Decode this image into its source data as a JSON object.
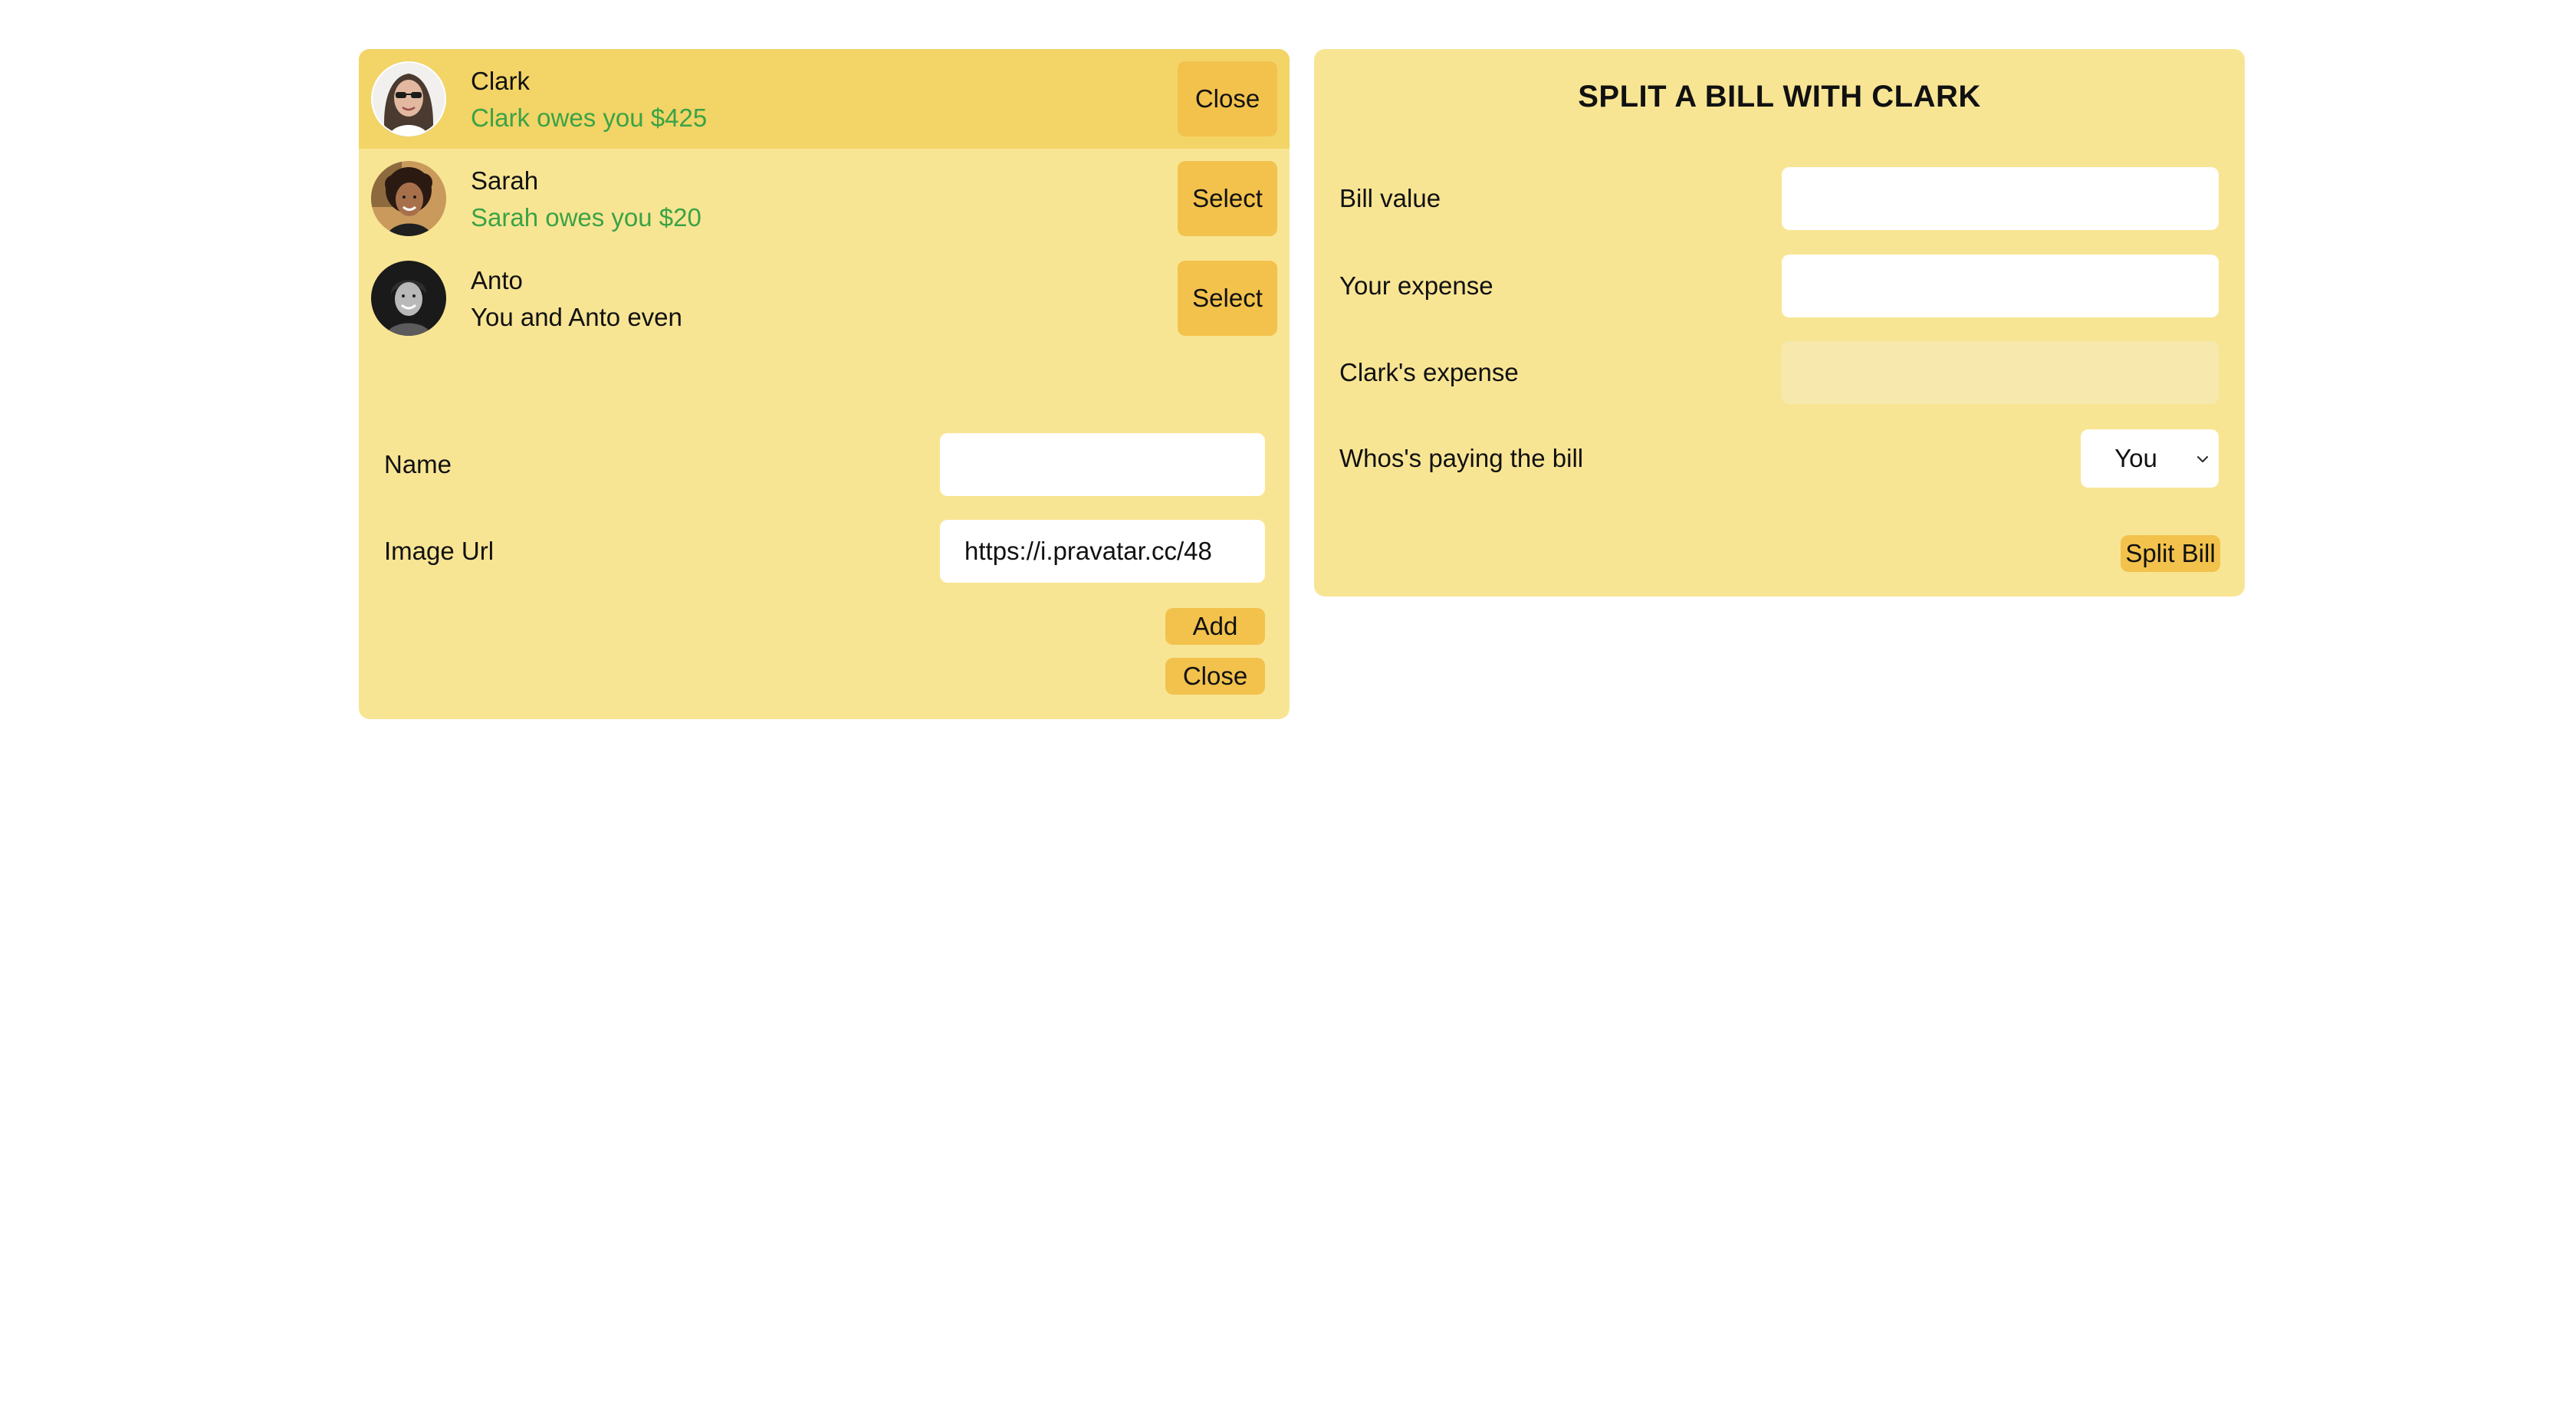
{
  "friends": [
    {
      "name": "Clark",
      "status": "Clark owes you $425",
      "status_color": "#3aa345",
      "button_label": "Close",
      "selected": true,
      "avatar_icon": "avatar-woman-sunglasses"
    },
    {
      "name": "Sarah",
      "status": "Sarah owes you $20",
      "status_color": "#3aa345",
      "button_label": "Select",
      "selected": false,
      "avatar_icon": "avatar-woman-curly-hair"
    },
    {
      "name": "Anto",
      "status": "You and Anto even",
      "status_color": "#111111",
      "button_label": "Select",
      "selected": false,
      "avatar_icon": "avatar-man-grayscale"
    }
  ],
  "add_friend_form": {
    "name_label": "Name",
    "name_value": "",
    "image_label": "Image Url",
    "image_value": "https://i.pravatar.cc/48",
    "add_label": "Add",
    "close_label": "Close"
  },
  "split_form": {
    "title": "SPLIT A BILL WITH CLARK",
    "bill_label": "Bill value",
    "bill_value": "",
    "your_expense_label": "Your expense",
    "your_expense_value": "",
    "friend_expense_label": "Clark's expense",
    "friend_expense_value": "",
    "payer_label": "Whos's paying the bill",
    "payer_selected": "You",
    "submit_label": "Split Bill"
  },
  "colors": {
    "panel": "#f8e594",
    "selected_row": "#f3d467",
    "button": "#f2c24c",
    "positive": "#3aa345",
    "disabled_input": "#f7e8ad"
  }
}
